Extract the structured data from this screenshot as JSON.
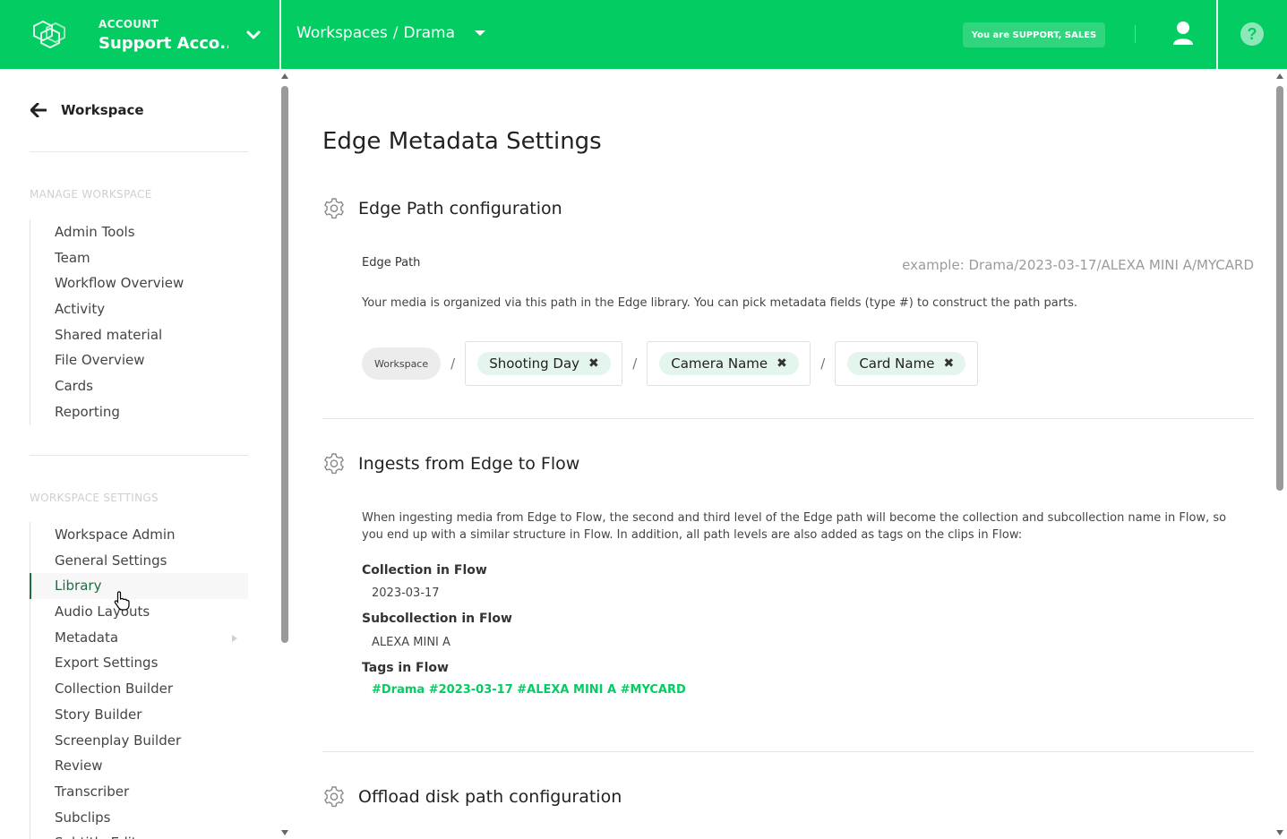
{
  "header": {
    "account_label": "ACCOUNT",
    "account_name": "Support Acco...",
    "breadcrumb_root": "Workspaces",
    "breadcrumb_sep": "/",
    "breadcrumb_current": "Drama",
    "role_badge": "You are SUPPORT, SALES",
    "brand_color": "#03cc62"
  },
  "sidebar": {
    "back_label": "Workspace",
    "manage_heading": "MANAGE WORKSPACE",
    "manage_items": [
      {
        "label": "Admin Tools"
      },
      {
        "label": "Team"
      },
      {
        "label": "Workflow Overview"
      },
      {
        "label": "Activity"
      },
      {
        "label": "Shared material"
      },
      {
        "label": "File Overview"
      },
      {
        "label": "Cards"
      },
      {
        "label": "Reporting"
      }
    ],
    "settings_heading": "WORKSPACE SETTINGS",
    "settings_items": [
      {
        "label": "Workspace Admin"
      },
      {
        "label": "General Settings"
      },
      {
        "label": "Library",
        "active": true
      },
      {
        "label": "Audio Layouts"
      },
      {
        "label": "Metadata",
        "has_submenu": true
      },
      {
        "label": "Export Settings"
      },
      {
        "label": "Collection Builder"
      },
      {
        "label": "Story Builder"
      },
      {
        "label": "Screenplay Builder"
      },
      {
        "label": "Review"
      },
      {
        "label": "Transcriber"
      },
      {
        "label": "Subclips"
      },
      {
        "label": "Subtitle Editor"
      }
    ]
  },
  "main": {
    "title": "Edge Metadata Settings",
    "edge_path": {
      "section_title": "Edge Path configuration",
      "label": "Edge Path",
      "example": "example: Drama/2023-03-17/ALEXA MINI A/MYCARD",
      "description": "Your media is organized via this path in the Edge library. You can pick metadata fields (type #) to construct the path parts.",
      "root_pill": "Workspace",
      "separator": "/",
      "parts": [
        "Shooting Day",
        "Camera Name",
        "Card Name"
      ],
      "remove_glyph": "✖"
    },
    "ingest": {
      "section_title": "Ingests from Edge to Flow",
      "description": "When ingesting media from Edge to Flow, the second and third level of the Edge path will become the collection and subcollection name in Flow, so you end up with a similar structure in Flow. In addition, all path levels are also added as tags on the clips in Flow:",
      "collection_label": "Collection in Flow",
      "collection_value": "2023-03-17",
      "subcollection_label": "Subcollection in Flow",
      "subcollection_value": "ALEXA MINI A",
      "tags_label": "Tags in Flow",
      "tags_value": "#Drama #2023-03-17 #ALEXA MINI A #MYCARD"
    },
    "offload": {
      "section_title": "Offload disk path configuration"
    }
  }
}
